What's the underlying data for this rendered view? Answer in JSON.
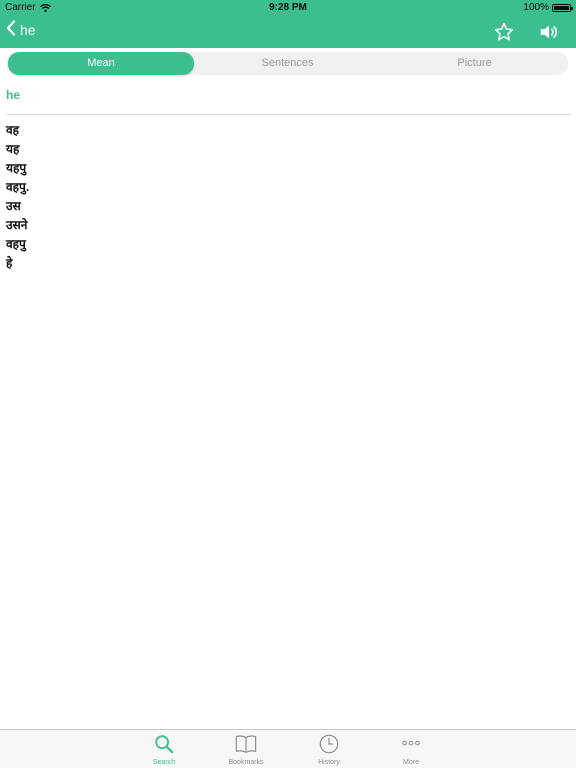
{
  "status": {
    "carrier": "Carrier",
    "time": "9:28 PM",
    "battery": "100%"
  },
  "nav": {
    "title": "he",
    "back_icon": "chevron-left-icon",
    "star_icon": "star-icon",
    "speaker_icon": "speaker-icon"
  },
  "segments": {
    "mean": "Mean",
    "sentences": "Sentences",
    "picture": "Picture",
    "selected": "Mean"
  },
  "content": {
    "headword": "he",
    "meanings": [
      "वह",
      "यह",
      "यहपु",
      "वहपु.",
      "उस",
      "उसने",
      "वहपु",
      "हे"
    ]
  },
  "tabs": [
    {
      "label": "Search",
      "icon": "search-icon",
      "active": true
    },
    {
      "label": "Bookmarks",
      "icon": "book-icon",
      "active": false
    },
    {
      "label": "History",
      "icon": "clock-icon",
      "active": false
    },
    {
      "label": "More",
      "icon": "more-icon",
      "active": false
    }
  ],
  "colors": {
    "accent": "#3cbf8f",
    "inactive": "#8e8e8e"
  }
}
